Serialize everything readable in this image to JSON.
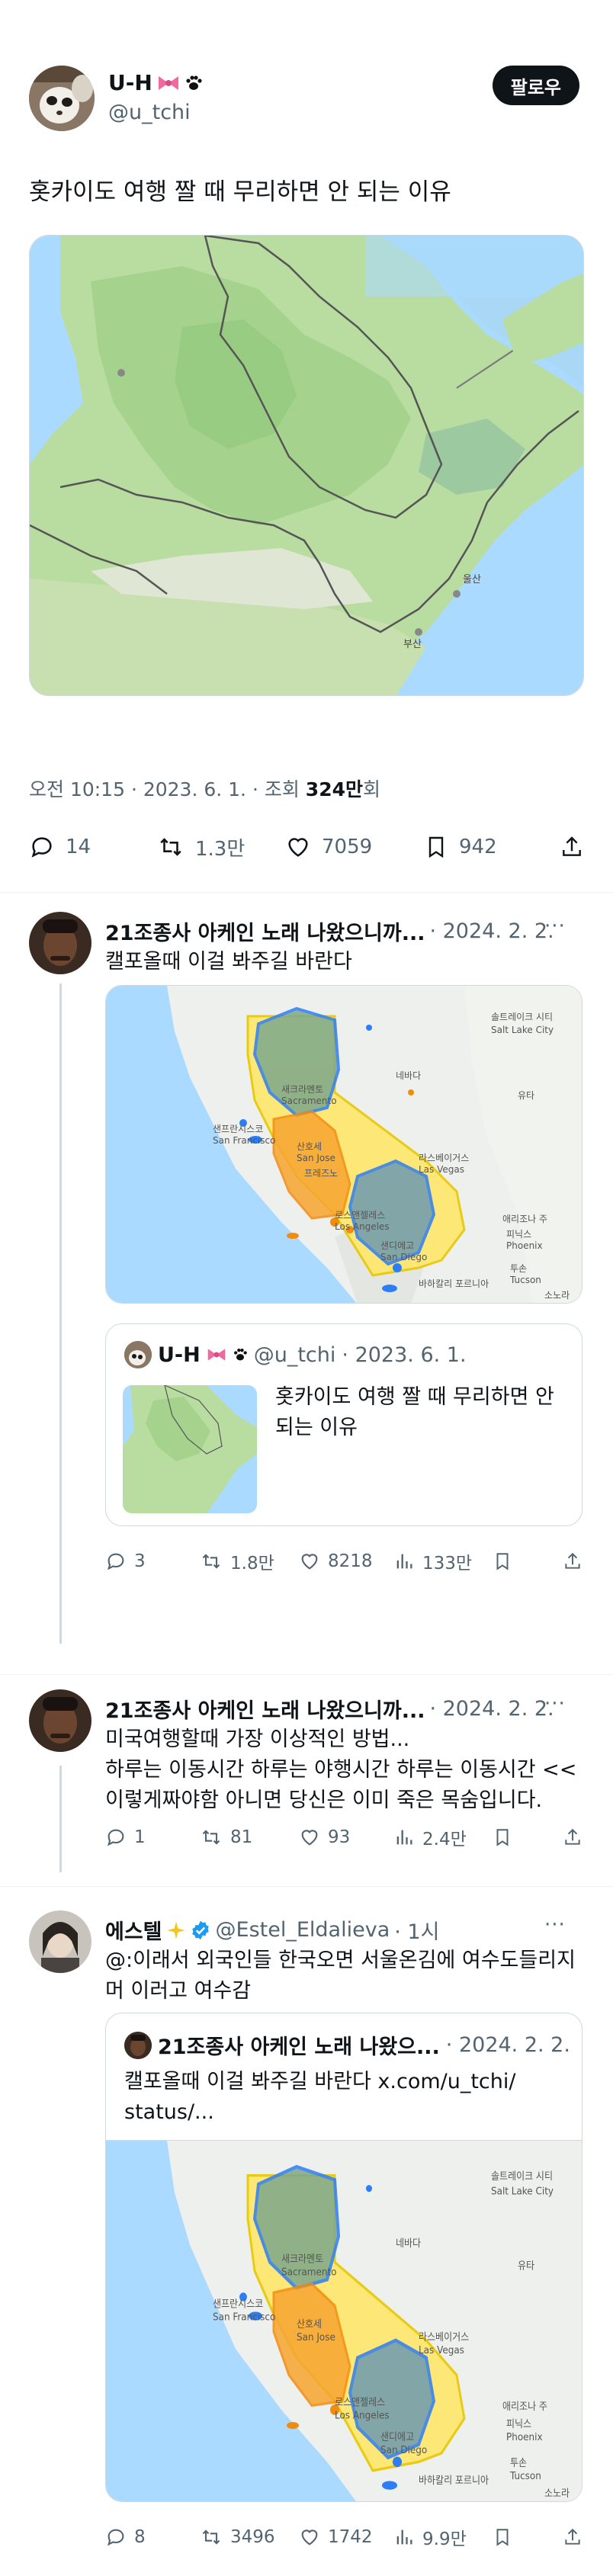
{
  "tweet": {
    "author_name": "U-H",
    "author_handle": "@u_tchi",
    "follow_label": "팔로우",
    "text": "홋카이도 여행 짤 때 무리하면 안 되는 이유",
    "time": "오전 10:15 · 2023. 6. 1. · 조회 ",
    "views": "324만",
    "views_suffix": "회",
    "replies": "14",
    "retweets": "1.3만",
    "likes": "7059",
    "bookmarks": "942"
  },
  "replies": [
    {
      "name": "21조종사 아케인 노래 나왔으니까...",
      "meta": "· 2024. 2. 2.",
      "text": "캘포올때 이걸 봐주길 바란다",
      "quote": {
        "name": "U-H",
        "handle": "@u_tchi",
        "date": "· 2023. 6. 1.",
        "text": "홋카이도 여행 짤 때 무리하면 안 되는 이유"
      },
      "stats": {
        "replies": "3",
        "retweets": "1.8만",
        "likes": "8218",
        "views": "133만"
      }
    },
    {
      "name": "21조종사 아케인 노래 나왔으니까...",
      "meta": "· 2024. 2. 2.",
      "text_lines": [
        "미국여행할때 가장 이상적인 방법...",
        "하루는 이동시간 하루는 야행시간 하루는 이동시간 <<",
        "이렇게짜야함 아니면 당신은 이미 죽은 목숨입니다."
      ],
      "stats": {
        "replies": "1",
        "retweets": "81",
        "likes": "93",
        "views": "2.4만"
      }
    },
    {
      "name": "에스텔",
      "handle": "@Estel_Eldalieva",
      "meta": "· 1시",
      "text_lines": [
        "@:이래서 외국인들 한국오면 서울온김에 여수도들리지",
        "머 이러고 여수감"
      ],
      "quote": {
        "name": "21조종사 아케인 노래 나왔으...",
        "date": "· 2024. 2. 2.",
        "text_lines": [
          "캘포올때 이걸 봐주길 바란다 x.com/u_tchi/",
          "status/..."
        ]
      },
      "stats": {
        "replies": "8",
        "retweets": "3496",
        "likes": "1742",
        "views": "9.9만"
      }
    }
  ],
  "map_labels": {
    "sf": "샌프란시스코",
    "sf_en": "San Francisco",
    "sac": "새크라멘토",
    "sac_en": "Sacramento",
    "sj": "산호세",
    "sj_en": "San Jose",
    "lv": "라스베이거스",
    "lv_en": "Las Vegas",
    "la": "로스앤젤레스",
    "la_en": "Los Angeles",
    "sd": "샌디에고",
    "sd_en": "San Diego",
    "slc": "솔트레이크 시티",
    "slc_en": "Salt Lake City",
    "phx": "피닉스",
    "phx_en": "Phoenix",
    "tuc": "투손",
    "tuc_en": "Tucson",
    "nv": "네바다",
    "ut": "유타",
    "az": "애리조나 주",
    "bc": "바하칼리 포르니아",
    "son": "소노라",
    "fresno": "프레즈노",
    "ul": "울산",
    "bs": "부산"
  },
  "colors": {
    "accent": "#1d9bf0",
    "text": "#0f1419",
    "muted": "#536471"
  }
}
